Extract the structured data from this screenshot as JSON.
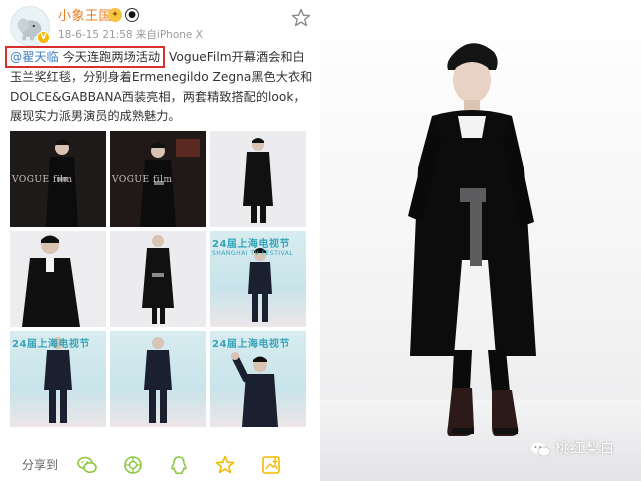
{
  "post": {
    "username": "小象王国",
    "meta": "18-6-15 21:58  来自iPhone X",
    "mention": "@翟天临",
    "mention_tail": " 今天连跑两场活动",
    "body": " VogueFilm开幕酒会和白玉兰奖红毯，分别身着Ermenegildo Zegna黑色大衣和DOLCE&GABBANA西装亮相，两套精致搭配的look，展现实力派男演员的成熟魅力。",
    "tiles": [
      {
        "style": "dark",
        "caption": "VOGUE film"
      },
      {
        "style": "dark",
        "caption": "VOGUE film"
      },
      {
        "style": "light",
        "caption": ""
      },
      {
        "style": "light",
        "caption": ""
      },
      {
        "style": "light",
        "caption": ""
      },
      {
        "style": "event",
        "caption": "24届上海电视节"
      },
      {
        "style": "event",
        "caption": "24届上海电视节"
      },
      {
        "style": "event",
        "caption": ""
      },
      {
        "style": "event",
        "caption": "24届上海电视节"
      }
    ],
    "tile_subcaption": "SHANGHAI TV FESTIVAL",
    "share_label": "分享到",
    "share_icons": [
      "wechat-icon",
      "moments-icon",
      "qq-icon",
      "favorite-star-icon",
      "save-image-icon"
    ]
  },
  "photo": {
    "watermark": "桃红梨白"
  },
  "colors": {
    "username": "#ea7b21",
    "mention": "#3b7ec2",
    "highlight_box": "#d9302b",
    "share_icon": "#8dc63f",
    "favorite_icon": "#f5b800"
  }
}
